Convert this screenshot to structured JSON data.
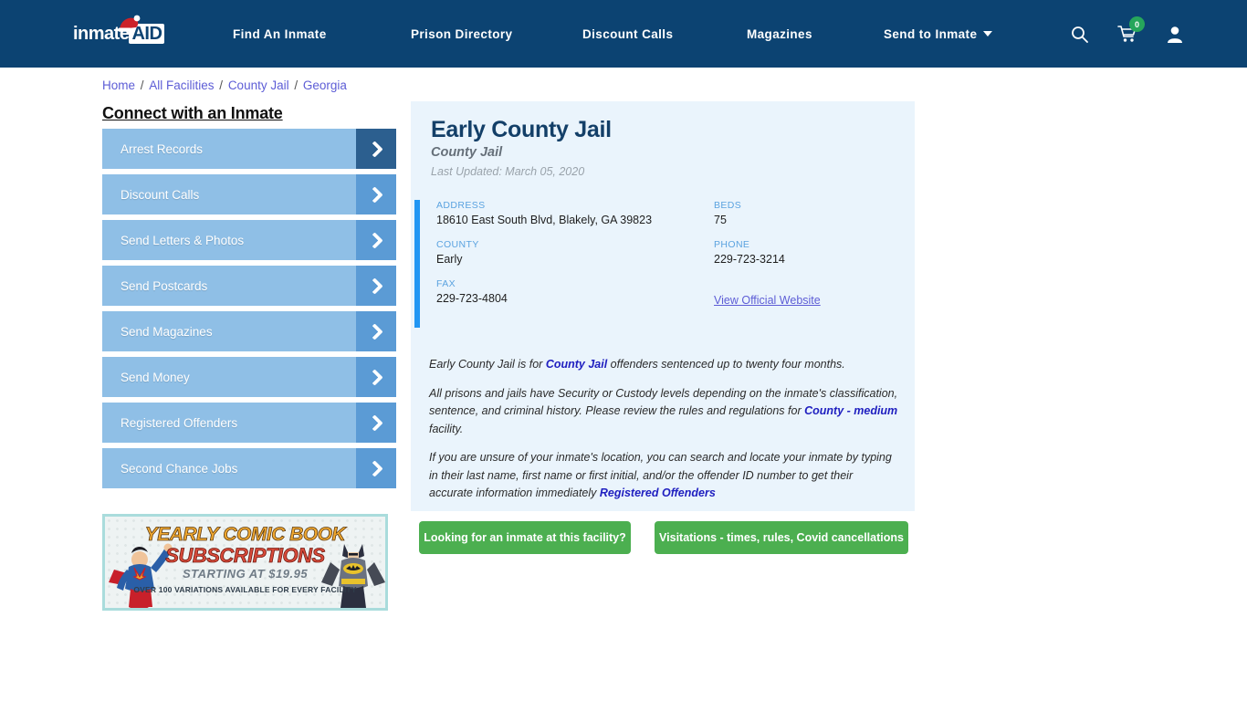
{
  "header": {
    "logo": {
      "text_primary": "inmate",
      "text_accent": "AID",
      "icon": "santa-hat-icon"
    },
    "nav": [
      {
        "label": "Find An Inmate",
        "has_caret": false
      },
      {
        "label": "Prison Directory",
        "has_caret": false
      },
      {
        "label": "Discount Calls",
        "has_caret": false
      },
      {
        "label": "Magazines",
        "has_caret": false
      },
      {
        "label": "Send to Inmate",
        "has_caret": true
      }
    ],
    "icons": {
      "search": "search-icon",
      "cart": "shopping-cart-icon",
      "cart_count": "0",
      "account": "user-account-icon"
    },
    "bg_color": "#0c4372",
    "badge_color": "#26a65b"
  },
  "breadcrumb": {
    "items": [
      "Home",
      "All Facilities",
      "County Jail",
      "Georgia"
    ],
    "separator": "/",
    "link_color": "#5d5dd6"
  },
  "sidebar": {
    "title": "Connect with an Inmate",
    "items": [
      {
        "label": "Arrest Records",
        "active": true
      },
      {
        "label": "Discount Calls",
        "active": false
      },
      {
        "label": "Send Letters & Photos",
        "active": false
      },
      {
        "label": "Send Postcards",
        "active": false
      },
      {
        "label": "Send Magazines",
        "active": false
      },
      {
        "label": "Send Money",
        "active": false
      },
      {
        "label": "Registered Offenders",
        "active": false
      },
      {
        "label": "Second Chance Jobs",
        "active": false
      }
    ],
    "arrow_icon": "chevron-right-icon",
    "item_color": "#8fbfe6",
    "arrow_color": "#5b9bd5",
    "arrow_active_color": "#2c5f8f"
  },
  "ad": {
    "line1": "YEARLY COMIC BOOK",
    "line2": "SUBSCRIPTIONS",
    "line3": "STARTING AT $19.95",
    "line4": "OVER 100 VARIATIONS AVAILABLE FOR EVERY FACILITY",
    "left_character": "superman-illustration",
    "right_character": "batman-illustration"
  },
  "facility": {
    "name": "Early County Jail",
    "type": "County Jail",
    "last_updated": "Last Updated: March 05, 2020",
    "details": {
      "address_label": "ADDRESS",
      "address_value": "18610 East South Blvd, Blakely, GA 39823",
      "county_label": "COUNTY",
      "county_value": "Early",
      "fax_label": "FAX",
      "fax_value": "229-723-4804",
      "beds_label": "BEDS",
      "beds_value": "75",
      "phone_label": "PHONE",
      "phone_value": "229-723-3214",
      "website_link": "View Official Website"
    },
    "accent_color": "#2196f3",
    "panel_color": "#eaf4fc"
  },
  "copy": {
    "p1_a": "Early County Jail is for ",
    "p1_link": "County Jail",
    "p1_b": " offenders sentenced up to twenty four months.",
    "p2_a": "All prisons and jails have Security or Custody levels depending on the inmate's classification, sentence, and criminal history. Please review the rules and regulations for ",
    "p2_link": "County - medium",
    "p2_b": " facility.",
    "p3_a": "If you are unsure of your inmate's location, you can search and locate your inmate by typing in their last name, first name or first initial, and/or the offender ID number to get their accurate information immediately ",
    "p3_link": "Registered Offenders"
  },
  "buttons": {
    "inmate_search": "Looking for an inmate at this facility?",
    "visitations": "Visitations - times, rules, Covid cancellations",
    "color": "#4caf50"
  }
}
